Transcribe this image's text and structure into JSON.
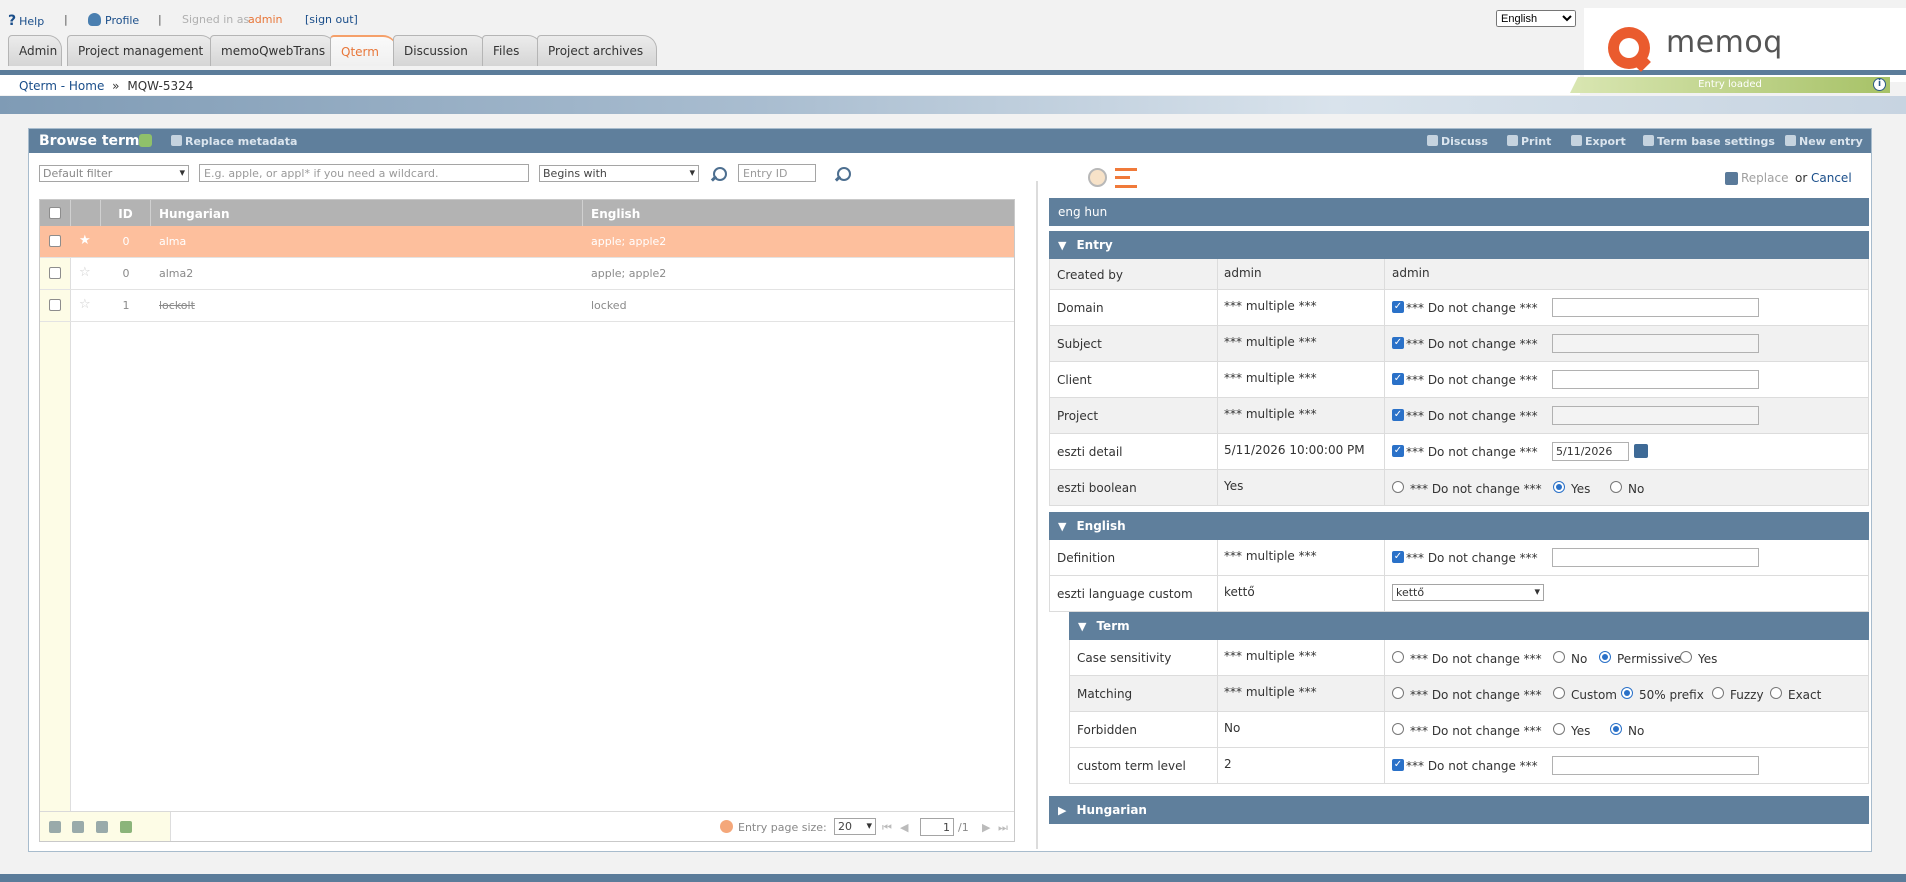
{
  "top": {
    "help": "Help",
    "profile": "Profile",
    "sep": "|",
    "signed_in_as": "Signed in as",
    "user": "admin",
    "sign_out": "[sign out]",
    "language": "English"
  },
  "tabs": [
    {
      "label": "Admin"
    },
    {
      "label": "Project management"
    },
    {
      "label": "memoQwebTrans"
    },
    {
      "label": "Qterm",
      "active": true
    },
    {
      "label": "Discussion"
    },
    {
      "label": "Files"
    },
    {
      "label": "Project archives"
    }
  ],
  "logo": "memoq",
  "breadcrumb": {
    "home": "Qterm - Home",
    "sep": "»",
    "current": "MQW-5324"
  },
  "status": {
    "text": "Entry loaded",
    "info": "i"
  },
  "panel": {
    "title": "Browse terms",
    "replace_metadata": "Replace metadata",
    "actions": {
      "discuss": "Discuss",
      "print": "Print",
      "export": "Export",
      "settings": "Term base settings",
      "new_entry": "New entry"
    }
  },
  "filter": {
    "default_filter": "Default filter",
    "search_placeholder": "E.g. apple, or appl* if you need a wildcard.",
    "match_mode": "Begins with",
    "entry_id_placeholder": "Entry ID"
  },
  "edit_actions": {
    "replace": "Replace",
    "or": "or",
    "cancel": "Cancel"
  },
  "grid": {
    "headers": {
      "id": "ID",
      "hungarian": "Hungarian",
      "english": "English"
    },
    "rows": [
      {
        "id": "0",
        "hungarian": "alma",
        "english": "apple; apple2"
      },
      {
        "id": "0",
        "hungarian": "alma2",
        "english": "apple; apple2"
      },
      {
        "id": "1",
        "hungarian": "lockolt",
        "english": "locked"
      }
    ],
    "footer": {
      "page_size_label": "Entry page size:",
      "page_size": "20",
      "page": "1",
      "total": "/1"
    }
  },
  "right": {
    "languages": "eng   hun",
    "entry": {
      "title": "Entry",
      "created_by_label": "Created by",
      "created_by_value": "admin",
      "created_by_new": "admin",
      "rows": [
        {
          "label": "Domain",
          "value": "*** multiple ***"
        },
        {
          "label": "Subject",
          "value": "*** multiple ***"
        },
        {
          "label": "Client",
          "value": "*** multiple ***"
        },
        {
          "label": "Project",
          "value": "*** multiple ***"
        },
        {
          "label": "eszti detail",
          "value": "5/11/2026 10:00:00 PM",
          "date": "5/11/2026"
        }
      ],
      "boolean": {
        "label": "eszti boolean",
        "value": "Yes"
      }
    },
    "do_not_change": "*** Do not change ***",
    "english": {
      "title": "English",
      "definition": {
        "label": "Definition",
        "value": "*** multiple ***"
      },
      "custom": {
        "label": "eszti language custom",
        "value": "kettő",
        "selected": "kettő"
      }
    },
    "term": {
      "title": "Term",
      "case": {
        "label": "Case sensitivity",
        "value": "*** multiple ***",
        "opts": {
          "no": "No",
          "permissive": "Permissive",
          "yes": "Yes"
        }
      },
      "matching": {
        "label": "Matching",
        "value": "*** multiple ***",
        "opts": {
          "custom": "Custom",
          "prefix": "50% prefix",
          "fuzzy": "Fuzzy",
          "exact": "Exact"
        }
      },
      "forbidden": {
        "label": "Forbidden",
        "value": "No",
        "opts": {
          "yes": "Yes",
          "no": "No"
        }
      },
      "level": {
        "label": "custom term level",
        "value": "2"
      }
    },
    "hungarian": {
      "title": "Hungarian"
    },
    "radio_yes": "Yes",
    "radio_no": "No"
  }
}
